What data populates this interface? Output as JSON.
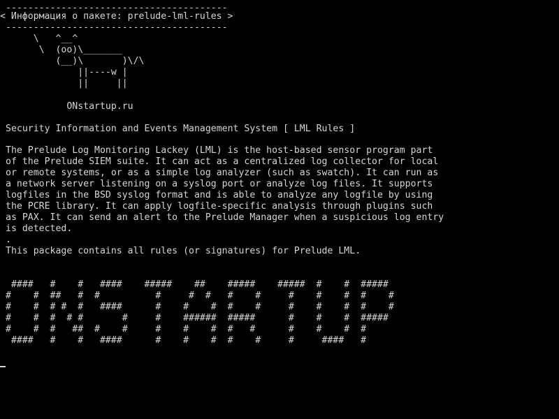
{
  "terminal": {
    "fg_color": "#d6d6d6",
    "bg_color": "#000000",
    "banner": {
      "rule_top": "----------------------------------------",
      "title": "< Информация о пакете: prelude-lml-rules >",
      "rule_bottom": "----------------------------------------"
    },
    "cow": [
      "     \\   ^__^",
      "      \\  (oo)\\_______",
      "         (__)\\       )\\/\\",
      "             ||----w |",
      "             ||     ||"
    ],
    "site": "           ONstartup.ru",
    "summary": "Security Information and Events Management System [ LML Rules ]",
    "description": [
      "The Prelude Log Monitoring Lackey (LML) is the host-based sensor program part",
      "of the Prelude SIEM suite. It can act as a centralized log collector for local",
      "or remote systems, or as a simple log analyzer (such as swatch). It can run as",
      "a network server listening on a syslog port or analyze log files. It supports",
      "logfiles in the BSD syslog format and is able to analyze any logfile by using",
      "the PCRE library. It can apply logfile-specific analysis through plugins such",
      "as PAX. It can send an alert to the Prelude Manager when a suspicious log entry",
      "is detected.",
      ".",
      "This package contains all rules (or signatures) for Prelude LML."
    ],
    "ascii_art": [
      " ####   #    #   ####    #####    ##    #####    #####  #    #  #####",
      "#    #  ##   #  #          #     #  #   #    #     #    #    #  #    #",
      "#    #  # #  #   ####      #    #    #  #    #     #    #    #  #    #",
      "#    #  #  # #       #     #    ######  #####      #    #    #  #####",
      "#    #  #   ##  #    #     #    #    #  #   #      #    #    #  #",
      " ####   #    #   ####      #    #    #  #    #     #     ####   #"
    ]
  }
}
